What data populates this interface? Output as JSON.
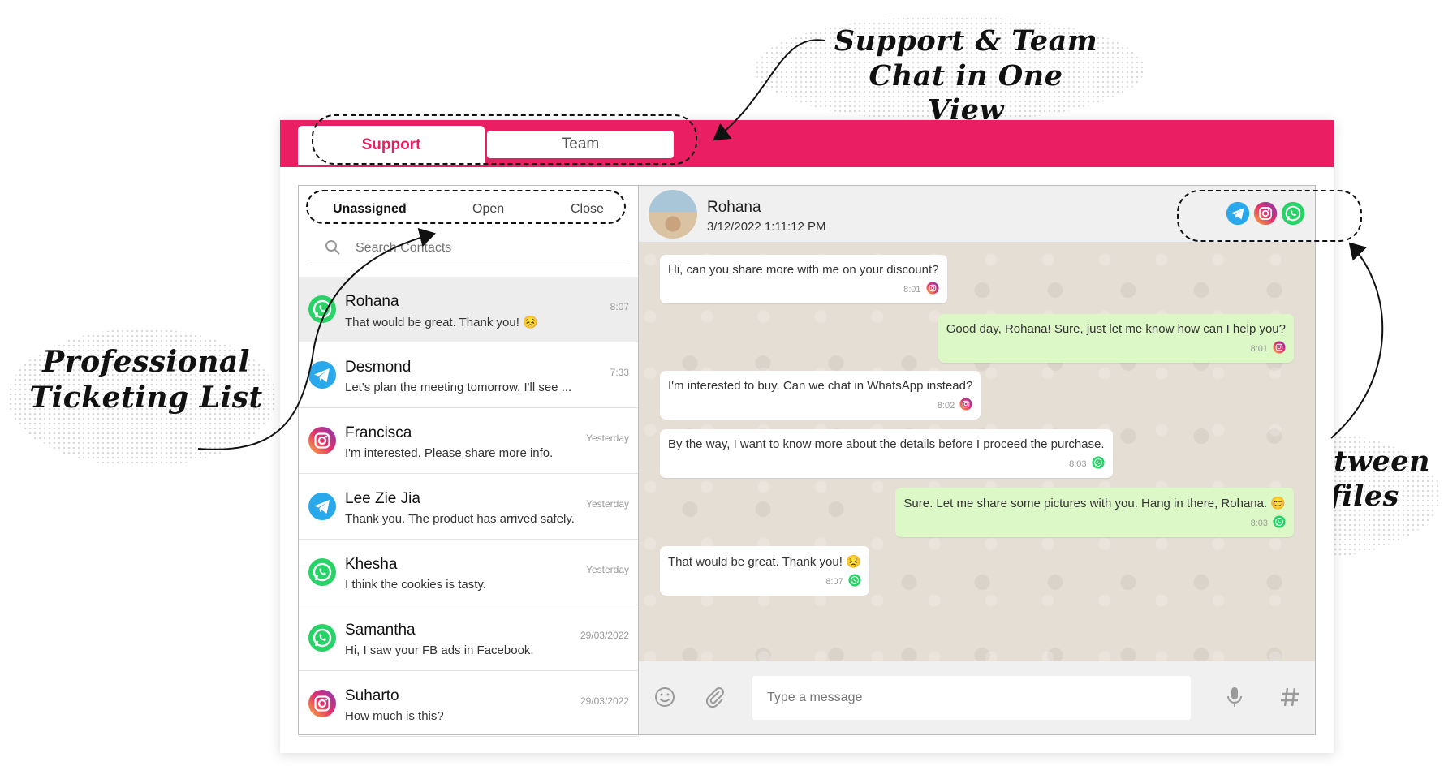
{
  "annotations": {
    "support_team": [
      "Support & Team",
      "Chat in One View"
    ],
    "ticketing": [
      "Professional",
      "Ticketing List"
    ],
    "sub_profiles": [
      "Switch between",
      "sub profiles"
    ]
  },
  "header": {
    "tabs": [
      {
        "label": "Support",
        "active": true
      },
      {
        "label": "Team",
        "active": false
      }
    ],
    "accent_color": "#e91e63"
  },
  "ticket_filters": {
    "items": [
      {
        "label": "Unassigned",
        "active": true
      },
      {
        "label": "Open",
        "active": false
      },
      {
        "label": "Close",
        "active": false
      }
    ]
  },
  "search": {
    "placeholder": "Search Contacts"
  },
  "contacts": [
    {
      "name": "Rohana",
      "preview": "That would be great. Thank you! 😣",
      "time": "8:07",
      "channel": "whatsapp-icon",
      "selected": true
    },
    {
      "name": "Desmond",
      "preview": "Let's plan the meeting tomorrow. I'll see ...",
      "time": "7:33",
      "channel": "telegram-icon",
      "selected": false
    },
    {
      "name": "Francisca",
      "preview": "I'm interested. Please share more info.",
      "time": "Yesterday",
      "channel": "instagram-icon",
      "selected": false
    },
    {
      "name": "Lee Zie Jia",
      "preview": "Thank you. The product has arrived safely.",
      "time": "Yesterday",
      "channel": "telegram-icon",
      "selected": false
    },
    {
      "name": "Khesha",
      "preview": "I think the cookies is tasty.",
      "time": "Yesterday",
      "channel": "whatsapp-icon",
      "selected": false
    },
    {
      "name": "Samantha",
      "preview": "Hi, I saw your FB ads in Facebook.",
      "time": "29/03/2022",
      "channel": "whatsapp-icon",
      "selected": false
    },
    {
      "name": "Suharto",
      "preview": "How much is this?",
      "time": "29/03/2022",
      "channel": "instagram-icon",
      "selected": false
    }
  ],
  "chat": {
    "contact_name": "Rohana",
    "timestamp": "3/12/2022 1:11:12 PM",
    "profiles": [
      "telegram-icon",
      "instagram-icon",
      "whatsapp-icon"
    ],
    "messages": [
      {
        "direction": "in",
        "text": "Hi, can you share more with me on your discount?",
        "time": "8:01",
        "channel": "instagram-icon"
      },
      {
        "direction": "out",
        "text": "Good day, Rohana! Sure, just let me know how can I help you?",
        "time": "8:01",
        "channel": "instagram-icon"
      },
      {
        "direction": "in",
        "text": "I'm interested to buy. Can we chat in WhatsApp instead?",
        "time": "8:02",
        "channel": "instagram-icon"
      },
      {
        "direction": "in",
        "text": "By the way, I want to know more about the details before I proceed the purchase.",
        "time": "8:03",
        "channel": "whatsapp-icon"
      },
      {
        "direction": "out",
        "text": "Sure. Let me share some pictures with you. Hang in there, Rohana. 😊",
        "time": "8:03",
        "channel": "whatsapp-icon"
      },
      {
        "direction": "in",
        "text": "That would be great. Thank you! 😣",
        "time": "8:07",
        "channel": "whatsapp-icon"
      }
    ]
  },
  "composer": {
    "placeholder": "Type a message",
    "icons": [
      "emoji-icon",
      "attachment-icon",
      "microphone-icon",
      "hashtag-icon"
    ]
  }
}
